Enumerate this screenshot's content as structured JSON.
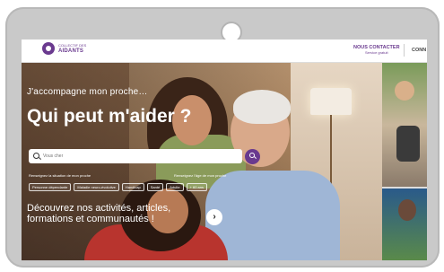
{
  "header": {
    "logo_small": "COLLECTIF DES",
    "logo_big": "AIDANTS",
    "contact_title": "NOUS CONTACTER",
    "contact_sub": "Service gratuit",
    "login_label": "CONN"
  },
  "hero": {
    "subtitle": "J'accompagne mon proche…",
    "title": "Qui peut m'aider ?",
    "search_placeholder": "Vous cher",
    "filter_label_left": "Renseignez la situation de mon proche",
    "filter_label_right": "Renseignez l'âge de mon proche",
    "chips": [
      "Personne dépendante",
      "Maladie neuro-évolutive",
      "Handicap",
      "Santé",
      "Adulte",
      "+ 60 ans"
    ],
    "discover_text": "Découvrez nos activités, articles, formations et communautés !",
    "next_symbol": "›"
  },
  "colors": {
    "brand": "#6a3a8f",
    "tablet_frame": "#c9c9c9"
  },
  "icons": {
    "search": "search-icon",
    "search_button": "search-button-icon",
    "next": "chevron-right-icon",
    "logo": "logo-icon",
    "camera": "camera-lens"
  }
}
